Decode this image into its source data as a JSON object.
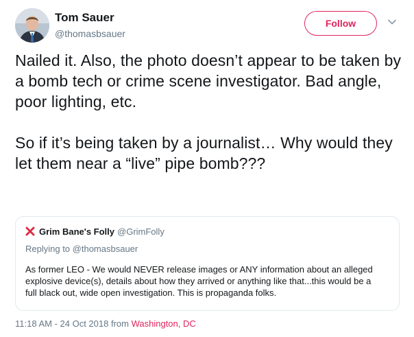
{
  "header": {
    "display_name": "Tom Sauer",
    "handle": "@thomasbsauer",
    "follow_label": "Follow"
  },
  "tweet": {
    "paragraphs": [
      "Nailed it.  Also, the photo doesn’t appear to be taken by a bomb tech or crime scene investigator.  Bad angle, poor lighting, etc.",
      "So if it’s being taken by a journalist… Why would they let them near a “live” pipe bomb???"
    ]
  },
  "quote": {
    "icon": "red-x-icon",
    "display_name": "Grim Bane's Folly",
    "handle": "@GrimFolly",
    "reply_context": "Replying to @thomasbsauer",
    "body": "As former LEO - We would NEVER release images or ANY information about an alleged explosive device(s), details about how they arrived or anything like that...this would be a full black out, wide open investigation. This is propaganda folks."
  },
  "footer": {
    "timestamp": "11:18 AM - 24 Oct 2018",
    "from_label": "from",
    "location": "Washington, DC"
  },
  "colors": {
    "accent": "#e0245e",
    "secondary_text": "#657786",
    "border": "#e1e8ed"
  }
}
